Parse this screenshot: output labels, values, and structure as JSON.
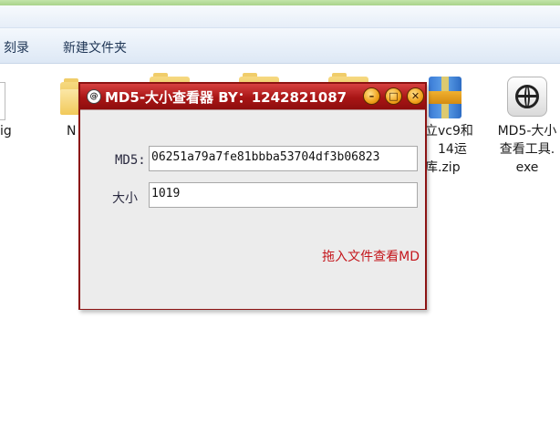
{
  "toolbar": {
    "burn_label": "刻录",
    "new_folder_label": "新建文件夹"
  },
  "desktop_files": {
    "left_partial_label": "ig",
    "folder_partial_label": "N",
    "zip_label_line1": "立vc9和",
    "zip_label_line2": "14运",
    "zip_label_line3": "库.zip",
    "exe_label_line1": "MD5-大小",
    "exe_label_line2": "查看工具.",
    "exe_label_line3": "exe"
  },
  "dialog": {
    "title": "MD5-大小查看器 BY：1242821087",
    "md5_label": "MD5:",
    "md5_value": "06251a79a7fe81bbba53704df3b06823",
    "size_label": "大小",
    "size_value": "1019",
    "drop_hint": "拖入文件查看MD"
  },
  "colors": {
    "titlebar": "#b01818",
    "hint": "#c4161c"
  }
}
